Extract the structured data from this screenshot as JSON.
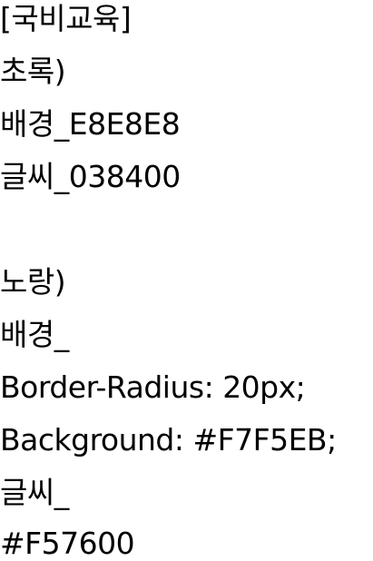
{
  "lines": [
    "[국비교육]",
    "초록)",
    "배경_E8E8E8",
    "글씨_038400",
    "",
    "노랑)",
    "배경_",
    "Border-Radius: 20px;",
    "Background: #F7F5EB;",
    "글씨_",
    "#F57600"
  ]
}
